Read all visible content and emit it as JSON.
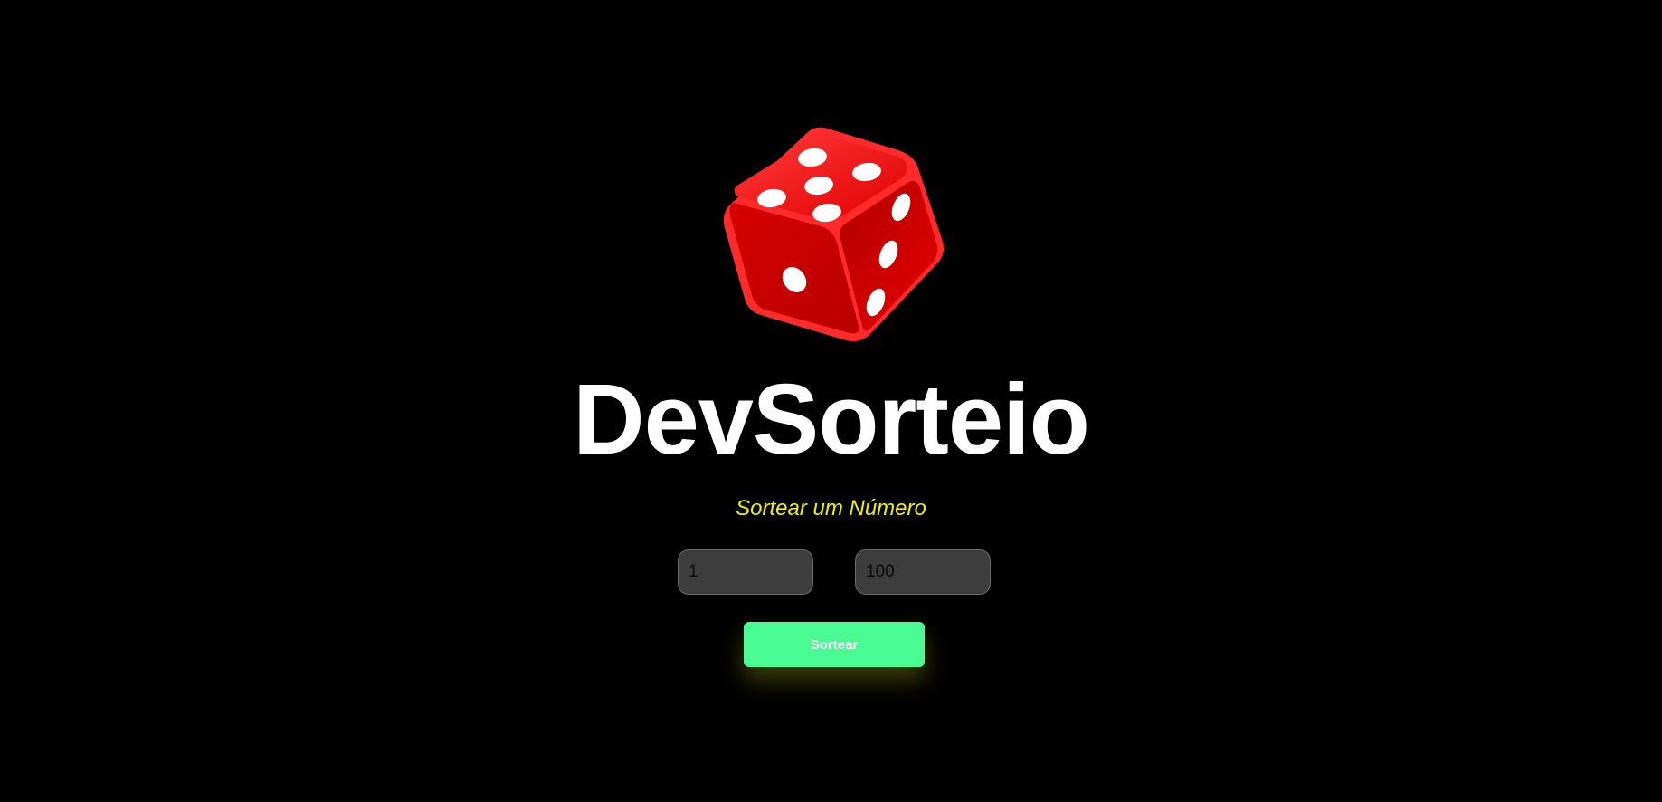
{
  "app": {
    "title": "DevSorteio",
    "subtitle": "Sortear um Número"
  },
  "logo": {
    "icon": "dice-icon",
    "color": "#e60000",
    "pip_color": "#ffffff"
  },
  "form": {
    "min_value": "1",
    "max_value": "100",
    "button_label": "Sortear",
    "button_color": "#4afa92"
  },
  "colors": {
    "background": "#000000",
    "title": "#ffffff",
    "subtitle": "#f0f000",
    "input_background": "#3d3d3d"
  }
}
